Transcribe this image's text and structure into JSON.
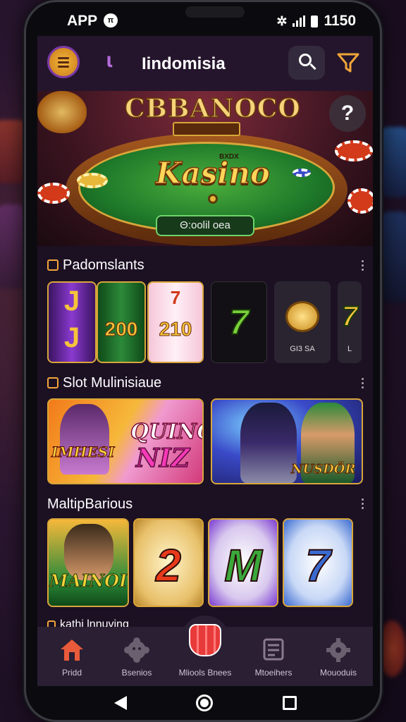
{
  "status": {
    "app_label": "APP",
    "badge": "π",
    "time": "1150"
  },
  "appbar": {
    "title": "Iindomisia",
    "logo_glyph": "ɩ"
  },
  "hero": {
    "brand": "CBBANOCO",
    "small_label": "BXDX",
    "title": "Kasino",
    "code_text": "Θ:oolil oea",
    "help_glyph": "?"
  },
  "sections": [
    {
      "title": "Padomslants"
    },
    {
      "title": "Slot Mulinisiaue"
    },
    {
      "title": "MaltipBarious"
    },
    {
      "title": "kathi lnnuving"
    }
  ],
  "row1": {
    "reels": [
      {
        "top": "J",
        "big": ""
      },
      {
        "top": "",
        "big": "200"
      },
      {
        "top": "7",
        "big": "210"
      }
    ],
    "tiles": [
      {
        "glyph": "7",
        "caption": ""
      },
      {
        "glyph": "",
        "caption": "GI3 SA"
      },
      {
        "glyph": "7",
        "caption": "L"
      }
    ]
  },
  "row2": {
    "left_top": "QUINQ",
    "left_bottom": "NIZ",
    "left_badge": "IMHESI",
    "right_label": "NUSDÖR"
  },
  "row3": {
    "tile1_label": "MAINOI",
    "tile2_glyph": "2",
    "tile3_glyph": "M",
    "tile4_glyph": "7"
  },
  "nav": [
    {
      "label": "Pridd",
      "icon": "home-icon"
    },
    {
      "label": "Bsenios",
      "icon": "gear-icon"
    },
    {
      "label": "Mliools Bnees",
      "icon": "popcorn-icon"
    },
    {
      "label": "Mtoeihers",
      "icon": "document-icon"
    },
    {
      "label": "Mouoduis",
      "icon": "settings-icon"
    }
  ],
  "colors": {
    "accent": "#f0a53a",
    "nav_home": "#e85a3a",
    "felt": "#1f7a2a"
  }
}
